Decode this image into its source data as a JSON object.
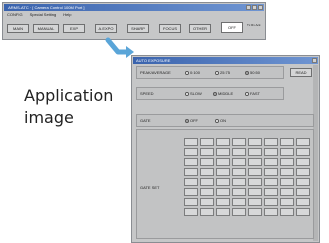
{
  "main_window": {
    "title": " ARMS-ATC · [ Camera Control 100M Port ]",
    "menu": [
      "CONFIG",
      "Special Setting",
      "Help"
    ],
    "toolbar": [
      {
        "label": "MAIN",
        "active": false
      },
      {
        "label": "MANUAL",
        "active": false
      },
      {
        "label": "EXP",
        "active": false
      },
      {
        "label": "A.EXPO",
        "active": false
      },
      {
        "label": "SHARP",
        "active": false
      },
      {
        "label": "FOCUS",
        "active": false
      },
      {
        "label": "OTHER",
        "active": false
      },
      {
        "label": "OFF",
        "active": true
      }
    ],
    "status_text": "Tx Rx Ack"
  },
  "dialog": {
    "title": "AUTO EXPOSURE",
    "peak_average": {
      "label": "PEAK/AVERAGE",
      "options": [
        {
          "label": "0:100",
          "checked": false
        },
        {
          "label": "25:75",
          "checked": false
        },
        {
          "label": "50:50",
          "checked": true
        }
      ],
      "read_button": "READ"
    },
    "speed": {
      "label": "SPEED",
      "options": [
        {
          "label": "SLOW",
          "checked": false
        },
        {
          "label": "MIDDLE",
          "checked": true
        },
        {
          "label": "FAST",
          "checked": false
        }
      ]
    },
    "gate": {
      "label": "GATE",
      "options": [
        {
          "label": "OFF",
          "checked": true
        },
        {
          "label": "ON",
          "checked": false
        }
      ]
    },
    "gate_set": {
      "label": "GATE SET",
      "rows": 8,
      "cols": 8
    }
  },
  "caption": {
    "line1": "Application",
    "line2": "image"
  },
  "colors": {
    "title_bar": "#3a63ad",
    "arrow": "#5aa5d8",
    "window_bg": "#c6c7c8"
  }
}
